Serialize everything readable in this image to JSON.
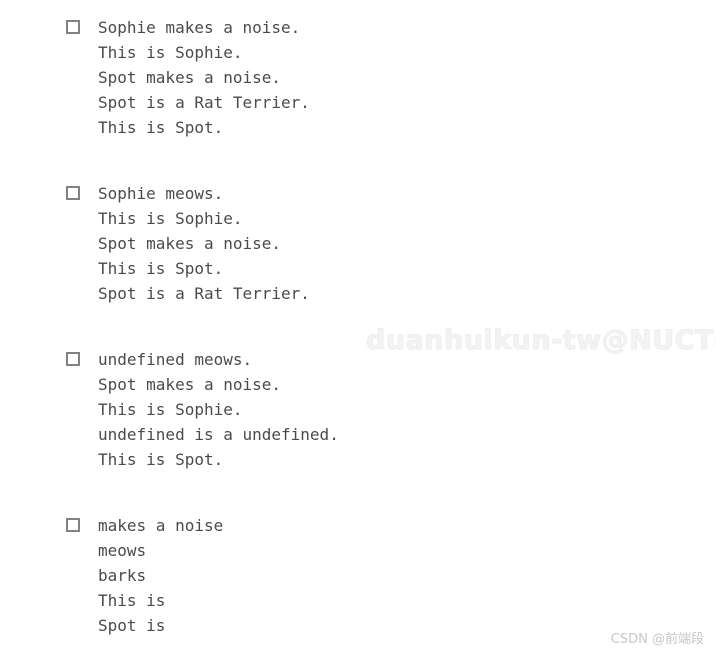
{
  "page": {
    "background_color": "#ffffff",
    "text_color": "#4b4b4b",
    "checkbox_border_color": "#828282"
  },
  "watermark": {
    "text": "duanhuikun-tw@NUCTECH",
    "color": "#f3f3f3"
  },
  "attribution": {
    "text": "CSDN @前端段",
    "color": "#c8c8c8"
  },
  "blocks": [
    {
      "checkbox_name": "checkbox-block-1",
      "checked": false,
      "lines": [
        "Sophie makes a noise.",
        "This is Sophie.",
        "Spot makes a noise.",
        "Spot is a Rat Terrier.",
        "This is Spot."
      ]
    },
    {
      "checkbox_name": "checkbox-block-2",
      "checked": false,
      "lines": [
        "Sophie meows.",
        "This is Sophie.",
        "Spot makes a noise.",
        "This is Spot.",
        "Spot is a Rat Terrier."
      ]
    },
    {
      "checkbox_name": "checkbox-block-3",
      "checked": false,
      "lines": [
        "undefined meows.",
        "Spot makes a noise.",
        "This is Sophie.",
        "undefined is a undefined.",
        "This is Spot."
      ]
    },
    {
      "checkbox_name": "checkbox-block-4",
      "checked": false,
      "lines": [
        "makes a noise",
        "meows",
        "barks",
        "This is",
        "Spot is"
      ]
    }
  ]
}
